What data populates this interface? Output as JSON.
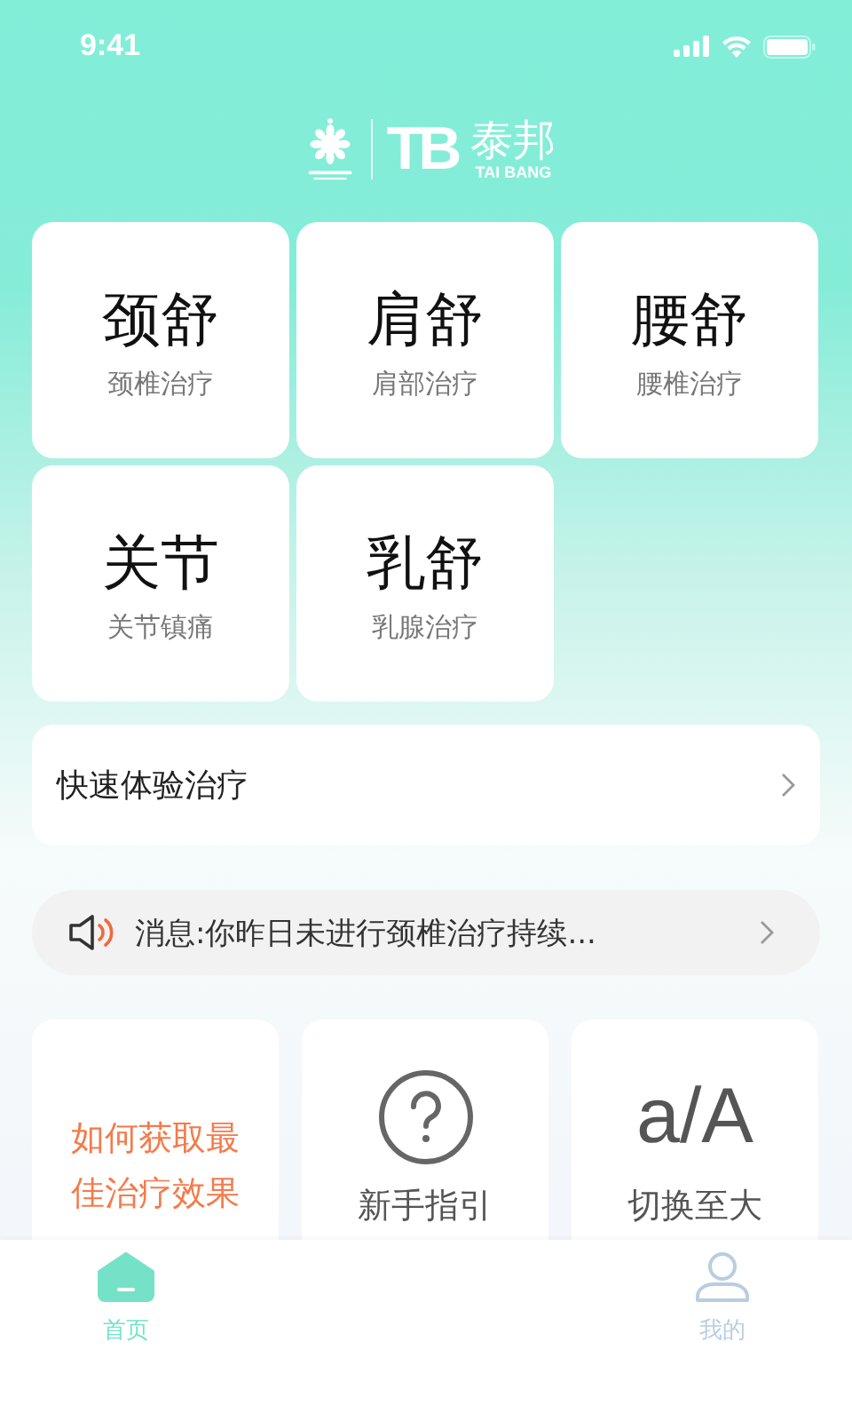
{
  "status_bar": {
    "time": "9:41"
  },
  "logo": {
    "mark": "TB",
    "name": "泰邦",
    "latin": "TAI BANG"
  },
  "treatments": [
    {
      "title": "颈舒",
      "subtitle": "颈椎治疗"
    },
    {
      "title": "肩舒",
      "subtitle": "肩部治疗"
    },
    {
      "title": "腰舒",
      "subtitle": "腰椎治疗"
    },
    {
      "title": "关节",
      "subtitle": "关节镇痛"
    },
    {
      "title": "乳舒",
      "subtitle": "乳腺治疗"
    }
  ],
  "quick_trial": {
    "label": "快速体验治疗"
  },
  "notice": {
    "text": "消息:你昨日未进行颈椎治疗持续..."
  },
  "feature_cards": [
    {
      "kind": "text",
      "label": "如何获取最佳治疗效果"
    },
    {
      "kind": "help",
      "label": "新手指引"
    },
    {
      "kind": "font",
      "glyph": "a/A",
      "label": "切换至大"
    }
  ],
  "tabs": [
    {
      "kind": "home",
      "label": "首页",
      "selected": true
    },
    {
      "kind": "profile",
      "label": "我的",
      "selected": false
    }
  ]
}
